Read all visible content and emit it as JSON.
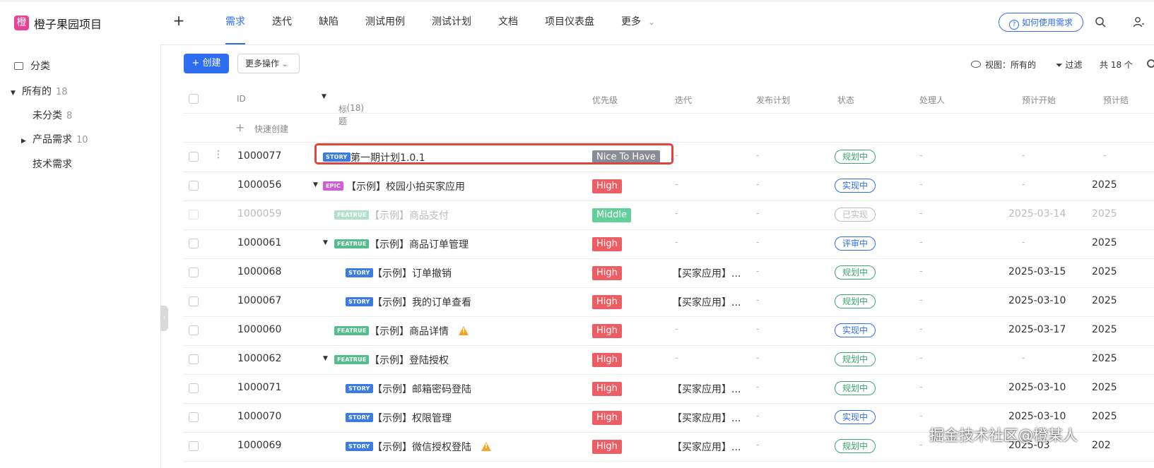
{
  "app": {
    "logo_char": "橙",
    "title": "橙子果园项目",
    "add_symbol": "+"
  },
  "nav": {
    "items": [
      "需求",
      "迭代",
      "缺陷",
      "测试用例",
      "测试计划",
      "文档",
      "项目仪表盘",
      "更多"
    ],
    "active_index": 0,
    "help_button": "如何使用需求"
  },
  "sidebar": {
    "header": "分类",
    "items": [
      {
        "label": "所有的",
        "count": "18"
      },
      {
        "label": "未分类",
        "count": "8"
      },
      {
        "label": "产品需求",
        "count": "10"
      },
      {
        "label": "技术需求",
        "count": ""
      }
    ]
  },
  "toolbar": {
    "create_label": "创建",
    "more_label": "更多操作",
    "view_label": "视图：所有的",
    "filter_label": "过滤",
    "total_label": "共 18 个"
  },
  "table": {
    "headers": {
      "id": "ID",
      "title": "标题",
      "title_count": "(18)",
      "priority": "优先级",
      "iteration": "迭代",
      "release": "发布计划",
      "status": "状态",
      "assignee": "处理人",
      "start": "预计开始",
      "end": "预计结"
    },
    "quick_create": "快速创建",
    "rows": [
      {
        "id": "1000077",
        "type": "STORY",
        "title": "第一期计划1.0.1",
        "priority": "Nice To Have",
        "iteration": "-",
        "release": "-",
        "status": "规划中",
        "assignee": "-",
        "start": "-",
        "end": "-"
      },
      {
        "id": "1000056",
        "type": "EPIC",
        "title": "【示例】校园小拍买家应用",
        "priority": "High",
        "iteration": "-",
        "release": "-",
        "status": "实现中",
        "assignee": "-",
        "start": "-",
        "end": "2025"
      },
      {
        "id": "1000059",
        "type": "FEATRUE",
        "title": "【示例】商品支付",
        "priority": "Middle",
        "iteration": "-",
        "release": "-",
        "status": "已实现",
        "assignee": "-",
        "start": "2025-03-14",
        "end": "2025"
      },
      {
        "id": "1000061",
        "type": "FEATRUE",
        "title": "【示例】商品订单管理",
        "priority": "High",
        "iteration": "-",
        "release": "-",
        "status": "评审中",
        "assignee": "-",
        "start": "-",
        "end": "2025"
      },
      {
        "id": "1000068",
        "type": "STORY",
        "title": "【示例】订单撤销",
        "priority": "High",
        "iteration": "【买家应用】...",
        "release": "-",
        "status": "规划中",
        "assignee": "-",
        "start": "2025-03-15",
        "end": "2025"
      },
      {
        "id": "1000067",
        "type": "STORY",
        "title": "【示例】我的订单查看",
        "priority": "High",
        "iteration": "【买家应用】...",
        "release": "-",
        "status": "规划中",
        "assignee": "-",
        "start": "2025-03-10",
        "end": "2025"
      },
      {
        "id": "1000060",
        "type": "FEATRUE",
        "title": "【示例】商品详情",
        "priority": "High",
        "iteration": "-",
        "release": "-",
        "status": "实现中",
        "assignee": "-",
        "start": "2025-03-17",
        "end": "2025"
      },
      {
        "id": "1000062",
        "type": "FEATRUE",
        "title": "【示例】登陆授权",
        "priority": "High",
        "iteration": "-",
        "release": "-",
        "status": "规划中",
        "assignee": "-",
        "start": "-",
        "end": "2025"
      },
      {
        "id": "1000071",
        "type": "STORY",
        "title": "【示例】邮箱密码登陆",
        "priority": "High",
        "iteration": "【买家应用】...",
        "release": "-",
        "status": "规划中",
        "assignee": "-",
        "start": "2025-03-10",
        "end": "2025"
      },
      {
        "id": "1000070",
        "type": "STORY",
        "title": "【示例】权限管理",
        "priority": "High",
        "iteration": "【买家应用】...",
        "release": "-",
        "status": "实现中",
        "assignee": "-",
        "start": "2025-03-10",
        "end": "2025"
      },
      {
        "id": "1000069",
        "type": "STORY",
        "title": "【示例】微信授权登陆",
        "priority": "High",
        "iteration": "【买家应用】...",
        "release": "-",
        "status": "规划中",
        "assignee": "-",
        "start": "2025-03",
        "end": "202"
      }
    ]
  },
  "colors": {
    "accent": "#2f6df0",
    "story_tag": "#3a7be6",
    "epic_tag": "#d15bd9",
    "feature_tag": "#52be8c",
    "high": "#ec5e63",
    "middle": "#62cf9a",
    "nice_to_have": "#878c96",
    "status_planning": "#3aa76d",
    "status_in_progress": "#2f6df0",
    "status_done": "#bbbbbb",
    "status_review": "#2f6df0"
  },
  "watermark": "掘金技术社区@橙某人"
}
